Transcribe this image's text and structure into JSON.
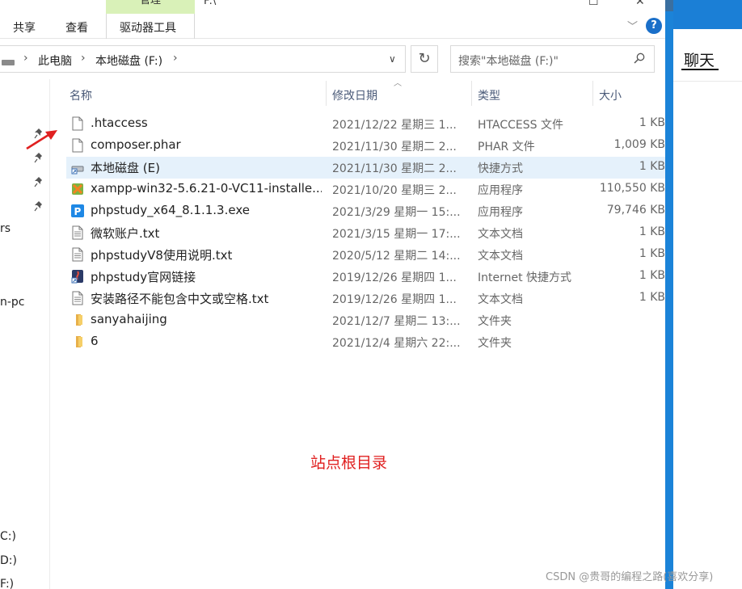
{
  "window": {
    "title_fragment": "F:\\",
    "context_tab_group": "管理",
    "ribbon_tabs": [
      "共享",
      "查看",
      "驱动器工具"
    ],
    "minimize_glyph": "—",
    "maximize_glyph": "☐",
    "close_glyph": "✕",
    "help_glyph": "?"
  },
  "address": {
    "crumbs": [
      "此电脑",
      "本地磁盘 (F:)"
    ]
  },
  "search": {
    "placeholder": "搜索\"本地磁盘 (F:)\""
  },
  "nav": {
    "fragments": [
      "rs",
      "n-pc",
      "C:)",
      "D:)",
      "F:)"
    ]
  },
  "columns": {
    "name": "名称",
    "date": "修改日期",
    "type": "类型",
    "size": "大小"
  },
  "files": [
    {
      "name": ".htaccess",
      "date": "2021/12/22 星期三 1...",
      "type": "HTACCESS 文件",
      "size": "1 KB",
      "icon": "blank-file-icon"
    },
    {
      "name": "composer.phar",
      "date": "2021/11/30 星期二 2...",
      "type": "PHAR 文件",
      "size": "1,009 KB",
      "icon": "blank-file-icon"
    },
    {
      "name": "本地磁盘 (E)",
      "date": "2021/11/30 星期二 2...",
      "type": "快捷方式",
      "size": "1 KB",
      "icon": "shortcut-drive-icon"
    },
    {
      "name": "xampp-win32-5.6.21-0-VC11-installe...",
      "date": "2021/10/20 星期三 2...",
      "type": "应用程序",
      "size": "110,550 KB",
      "icon": "xampp-installer-icon"
    },
    {
      "name": "phpstudy_x64_8.1.1.3.exe",
      "date": "2021/3/29 星期一 15:...",
      "type": "应用程序",
      "size": "79,746 KB",
      "icon": "phpstudy-app-icon"
    },
    {
      "name": "微软账户.txt",
      "date": "2021/3/15 星期一 17:...",
      "type": "文本文档",
      "size": "1 KB",
      "icon": "text-file-icon"
    },
    {
      "name": "phpstudyV8使用说明.txt",
      "date": "2020/5/12 星期二 14:...",
      "type": "文本文档",
      "size": "1 KB",
      "icon": "text-file-icon"
    },
    {
      "name": "phpstudy官网链接",
      "date": "2019/12/26 星期四 1...",
      "type": "Internet 快捷方式",
      "size": "1 KB",
      "icon": "internet-shortcut-icon"
    },
    {
      "name": "安装路径不能包含中文或空格.txt",
      "date": "2019/12/26 星期四 1...",
      "type": "文本文档",
      "size": "1 KB",
      "icon": "text-file-icon"
    },
    {
      "name": "sanyahaijing",
      "date": "2021/12/7 星期二 13:...",
      "type": "文件夹",
      "size": "",
      "icon": "folder-icon"
    },
    {
      "name": "6",
      "date": "2021/12/4 星期六 22:...",
      "type": "文件夹",
      "size": "",
      "icon": "folder-icon"
    }
  ],
  "selected_row_index": 2,
  "annotation": "站点根目录",
  "side_panel": {
    "chat_tab": "聊天"
  },
  "watermark": "CSDN @贵哥的编程之路(喜欢分享)",
  "colors": {
    "annotation_red": "#e02020",
    "selection_bg": "#e5f1fb",
    "context_tab_green": "#d9f1b8",
    "side_strip_blue": "#1b83d8",
    "help_blue": "#1a6fc9"
  }
}
